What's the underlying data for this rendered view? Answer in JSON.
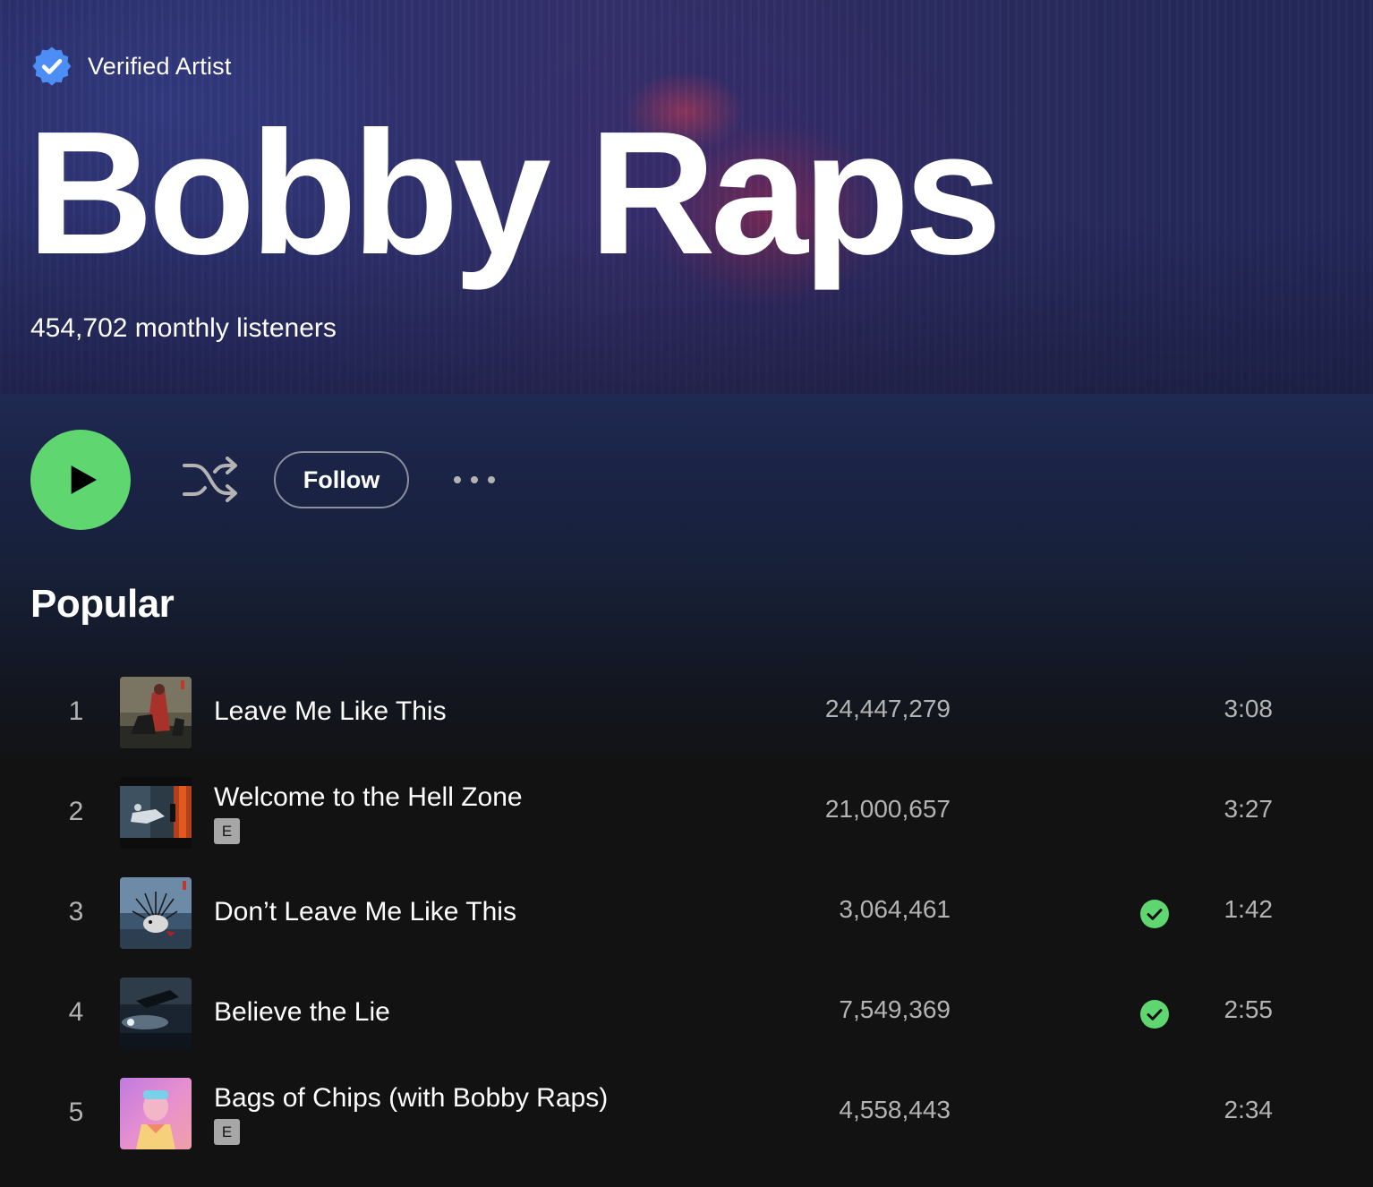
{
  "artist": {
    "verified_label": "Verified Artist",
    "name": "Bobby Raps",
    "monthly_listeners": "454,702 monthly listeners"
  },
  "actions": {
    "follow_label": "Follow"
  },
  "popular": {
    "title": "Popular",
    "tracks": [
      {
        "number": "1",
        "title": "Leave Me Like This",
        "explicit": false,
        "plays": "24,447,279",
        "saved": false,
        "duration": "3:08"
      },
      {
        "number": "2",
        "title": "Welcome to the Hell Zone",
        "explicit": true,
        "explicit_label": "E",
        "plays": "21,000,657",
        "saved": false,
        "duration": "3:27"
      },
      {
        "number": "3",
        "title": "Don’t Leave Me Like This",
        "explicit": false,
        "plays": "3,064,461",
        "saved": true,
        "duration": "1:42"
      },
      {
        "number": "4",
        "title": "Believe the Lie",
        "explicit": false,
        "plays": "7,549,369",
        "saved": true,
        "duration": "2:55"
      },
      {
        "number": "5",
        "title": "Bags of Chips (with Bobby Raps)",
        "explicit": true,
        "explicit_label": "E",
        "plays": "4,558,443",
        "saved": false,
        "duration": "2:34"
      }
    ]
  },
  "icons": {
    "verified": "verified-badge-icon",
    "play": "play-icon",
    "shuffle": "shuffle-icon",
    "more": "more-options-icon",
    "saved": "saved-check-icon"
  },
  "colors": {
    "accent_green": "#5fd66f",
    "verified_blue": "#4c8df6",
    "background": "#121212",
    "text_secondary": "#b3b3b3"
  }
}
